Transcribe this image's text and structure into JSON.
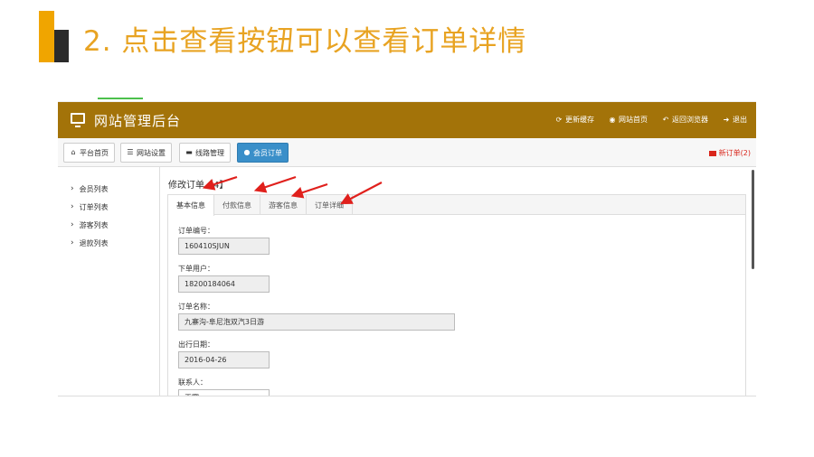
{
  "slide": {
    "title": "2. 点击查看按钮可以查看订单详情"
  },
  "header": {
    "app_title": "网站管理后台",
    "links": [
      {
        "label": "更新缓存",
        "icon": "refresh-icon"
      },
      {
        "label": "网站首页",
        "icon": "globe-icon"
      },
      {
        "label": "返回浏览器",
        "icon": "reply-icon"
      },
      {
        "label": "退出",
        "icon": "logout-icon"
      }
    ]
  },
  "toolbar": {
    "buttons": [
      {
        "label": "平台首页",
        "icon": "home-icon"
      },
      {
        "label": "网站设置",
        "icon": "list-icon"
      },
      {
        "label": "线路管理",
        "icon": "folder-icon"
      },
      {
        "label": "会员订单",
        "icon": "user-icon",
        "active": true
      }
    ],
    "new_orders": "新订单(2)"
  },
  "sidebar": {
    "items": [
      {
        "label": "会员列表"
      },
      {
        "label": "订单列表"
      },
      {
        "label": "游客列表"
      },
      {
        "label": "退款列表"
      }
    ]
  },
  "main": {
    "edit_title": "修改订单【4】",
    "tabs": [
      {
        "label": "基本信息",
        "active": true
      },
      {
        "label": "付款信息"
      },
      {
        "label": "游客信息"
      },
      {
        "label": "订单详细"
      }
    ],
    "fields": [
      {
        "label": "订单编号：",
        "value": "160410SJUN"
      },
      {
        "label": "下单用户：",
        "value": "18200184064"
      },
      {
        "label": "订单名称：",
        "value": "九寨沟-阜尼泡双汽3日游"
      },
      {
        "label": "出行日期：",
        "value": "2016-04-26"
      },
      {
        "label": "联系人：",
        "value": "王赛"
      }
    ]
  },
  "colors": {
    "title_accent": "#e8a322",
    "topbar": "#a37309",
    "active_button": "#3a8fc9",
    "arrow": "#e0201c"
  }
}
